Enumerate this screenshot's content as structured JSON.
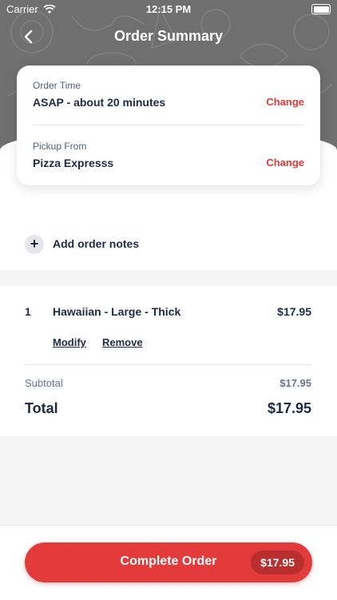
{
  "status_bar": {
    "carrier": "Carrier",
    "time": "12:15 PM"
  },
  "header": {
    "title": "Order Summary",
    "back_icon": "chevron-left-icon"
  },
  "order_time": {
    "label": "Order Time",
    "value": "ASAP - about 20 minutes",
    "action": "Change"
  },
  "pickup": {
    "label": "Pickup From",
    "value": "Pizza Expresss",
    "action": "Change"
  },
  "notes": {
    "label": "Add order notes",
    "icon": "+"
  },
  "items": [
    {
      "qty": "1",
      "name": "Hawaiian - Large - Thick",
      "price": "$17.95",
      "modify": "Modify",
      "remove": "Remove"
    }
  ],
  "summary": {
    "subtotal_label": "Subtotal",
    "subtotal_value": "$17.95",
    "total_label": "Total",
    "total_value": "$17.95"
  },
  "footer": {
    "button_label": "Complete Order",
    "button_price": "$17.95"
  },
  "colors": {
    "accent": "#e33b3b",
    "text": "#1f2a44",
    "header_bg": "#6f6f6f"
  }
}
